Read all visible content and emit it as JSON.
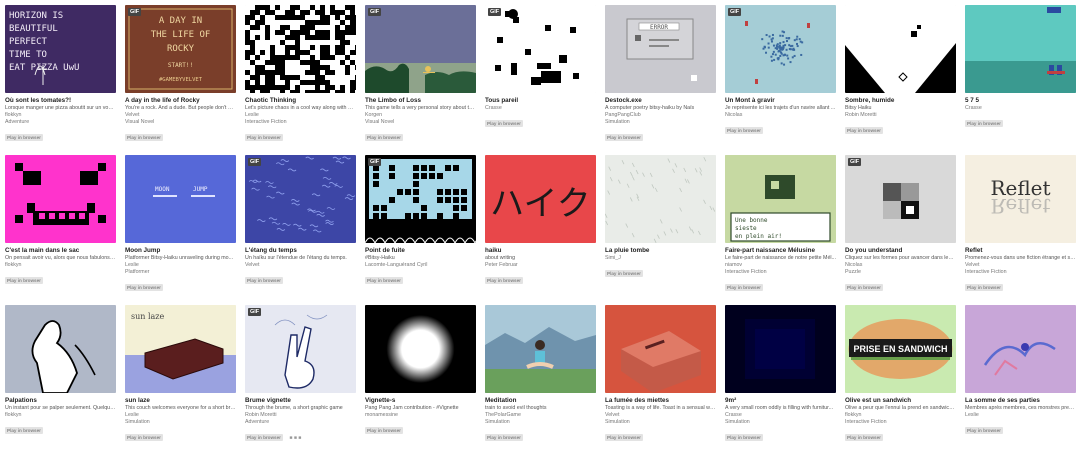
{
  "badge_label": "Play in browser",
  "gif_label": "GIF",
  "games": [
    {
      "title": "Où sont les tomates?!",
      "desc": "Lorsque manger une pizza aboutit sur un voya...",
      "author": "flokkyn",
      "genre": "Adventure",
      "gif": false,
      "thumb_text": "HORIZON IS BEAUTIFUL PERFECT TIME TO EAT PIZZA UwU",
      "thumb_icon": "handwritten-thumbnail-icon"
    },
    {
      "title": "A day in the life of Rocky",
      "desc": "You're a rock. And a dude. But people don't ge...",
      "author": "Velvet",
      "genre": "Visual Novel",
      "gif": true,
      "thumb_text": "A DAY IN THE LIFE OF ROCKY START!! #GAMEBYVELVET",
      "thumb_icon": "title-screen-thumbnail-icon"
    },
    {
      "title": "Chaotic Thinking",
      "desc": "Let's picture chaos in a cool way along with Ro...",
      "author": "Leslie",
      "genre": "Interactive Fiction",
      "gif": false,
      "thumb_icon": "noise-pattern-thumbnail-icon"
    },
    {
      "title": "The Limbo of Loss",
      "desc": "This game tells a very personal story about th...",
      "author": "Korgen",
      "genre": "Visual Novel",
      "gif": true,
      "thumb_icon": "landscape-thumbnail-icon"
    },
    {
      "title": "Tous pareil",
      "desc": "",
      "author": "Crasse",
      "genre": "",
      "gif": true,
      "thumb_icon": "pixel-blocks-thumbnail-icon"
    },
    {
      "title": "Destock.exe",
      "desc": "A computer poetry bitsy-haiku by Naïs",
      "author": "PangPangClub",
      "genre": "Simulation",
      "gif": false,
      "thumb_text": "ERROR",
      "thumb_icon": "error-window-thumbnail-icon"
    },
    {
      "title": "Un Mont à gravir",
      "desc": "Je représente ici les trajets d'un navire allant ...",
      "author": "Nicolas",
      "genre": "",
      "gif": true,
      "thumb_icon": "map-thumbnail-icon"
    },
    {
      "title": "Sombre, humide",
      "desc": "Bitsy Haiku",
      "author": "Robin Moretti",
      "genre": "",
      "gif": false,
      "thumb_icon": "triangles-thumbnail-icon"
    },
    {
      "title": "5 7 5",
      "desc": "",
      "author": "Crasse",
      "genre": "",
      "gif": false,
      "thumb_icon": "teal-pixel-thumbnail-icon"
    },
    {
      "title": "C'est la main dans le sac",
      "desc": "On pensait avoir vu, alors que nous fabulons s...",
      "author": "flokkyn",
      "genre": "",
      "gif": false,
      "thumb_icon": "pixel-face-thumbnail-icon"
    },
    {
      "title": "Moon Jump",
      "desc": "Platformer Bitsy-Haiku unraveling during mo...",
      "author": "Leslie",
      "genre": "Platformer",
      "gif": false,
      "thumb_text": "MOON JUMP",
      "thumb_icon": "moon-jump-thumbnail-icon"
    },
    {
      "title": "L'étang du temps",
      "desc": "Un haïku sur l'étendue de l'étang du temps.",
      "author": "Velvet",
      "genre": "",
      "gif": true,
      "thumb_icon": "pond-thumbnail-icon"
    },
    {
      "title": "Point de fuite",
      "desc": "#Bitsy-Haiku",
      "author": "Lacomte-Languérand Cyril",
      "genre": "",
      "gif": true,
      "thumb_icon": "maze-thumbnail-icon"
    },
    {
      "title": "haiku",
      "desc": "about writing",
      "author": "Peter Februar",
      "genre": "",
      "gif": false,
      "thumb_text": "ハイク",
      "thumb_icon": "kana-thumbnail-icon"
    },
    {
      "title": "La pluie tombe",
      "desc": "",
      "author": "Simi_J",
      "genre": "",
      "gif": false,
      "thumb_icon": "rain-thumbnail-icon"
    },
    {
      "title": "Faire-part naissance Mélusine",
      "desc": "Le faire-part de naissance de notre petite Mél...",
      "author": "niamov",
      "genre": "Interactive Fiction",
      "gif": false,
      "thumb_text": "Une bonne sieste en plein air!",
      "thumb_icon": "gameboy-thumbnail-icon"
    },
    {
      "title": "Do you understand",
      "desc": "Cliquez sur les formes pour avancer dans les s...",
      "author": "Nicolas",
      "genre": "Puzzle",
      "gif": true,
      "thumb_icon": "squares-thumbnail-icon"
    },
    {
      "title": "Reflet",
      "desc": "Promenez-vous dans une fiction étrange et sy...",
      "author": "Velvet",
      "genre": "Interactive Fiction",
      "gif": false,
      "thumb_text": "Reflet",
      "thumb_icon": "reflection-thumbnail-icon"
    },
    {
      "title": "Palpations",
      "desc": "Un instant pour se palper seulement. Quelque...",
      "author": "flokkyn",
      "genre": "",
      "gif": false,
      "thumb_icon": "figure-thumbnail-icon"
    },
    {
      "title": "sun laze",
      "desc": "This couch welcomes everyone for a short bre...",
      "author": "Leslie",
      "genre": "Simulation",
      "gif": false,
      "thumb_text": "sun laze",
      "thumb_icon": "couch-thumbnail-icon"
    },
    {
      "title": "Brume vignette",
      "desc": "Through the brume, a short graphic game",
      "author": "Robin Moretti",
      "genre": "Adventure",
      "gif": true,
      "platforms": "■ ■ ■",
      "thumb_icon": "hand-peace-thumbnail-icon"
    },
    {
      "title": "Vignette-s",
      "desc": "Pang Pang Jam contribution - #Vignette",
      "author": "monamessine",
      "genre": "",
      "gif": false,
      "thumb_icon": "glow-thumbnail-icon"
    },
    {
      "title": "Meditation",
      "desc": "train to avoid evil thoughts",
      "author": "ThePolarGame",
      "genre": "Simulation",
      "gif": false,
      "thumb_icon": "meditation-thumbnail-icon"
    },
    {
      "title": "La fumée des miettes",
      "desc": "Toasting is a way of life. Toast in a sensual way...",
      "author": "Velvet",
      "genre": "Simulation",
      "gif": false,
      "thumb_icon": "toaster-thumbnail-icon"
    },
    {
      "title": "9m²",
      "desc": "A very small room oddly is filling with furnitur...",
      "author": "Crasse",
      "genre": "Simulation",
      "gif": false,
      "thumb_icon": "dark-room-thumbnail-icon"
    },
    {
      "title": "Olive est un sandwich",
      "desc": "Olive a peur que l'ennui la prend en sandwich ...",
      "author": "flokkyn",
      "genre": "Interactive Fiction",
      "gif": false,
      "thumb_text": "PRISE EN SANDWICH",
      "thumb_icon": "sandwich-thumbnail-icon"
    },
    {
      "title": "La somme de ses parties",
      "desc": "Membres après membres, ces monstres pren...",
      "author": "Leslie",
      "genre": "",
      "gif": false,
      "thumb_icon": "creatures-thumbnail-icon"
    }
  ]
}
